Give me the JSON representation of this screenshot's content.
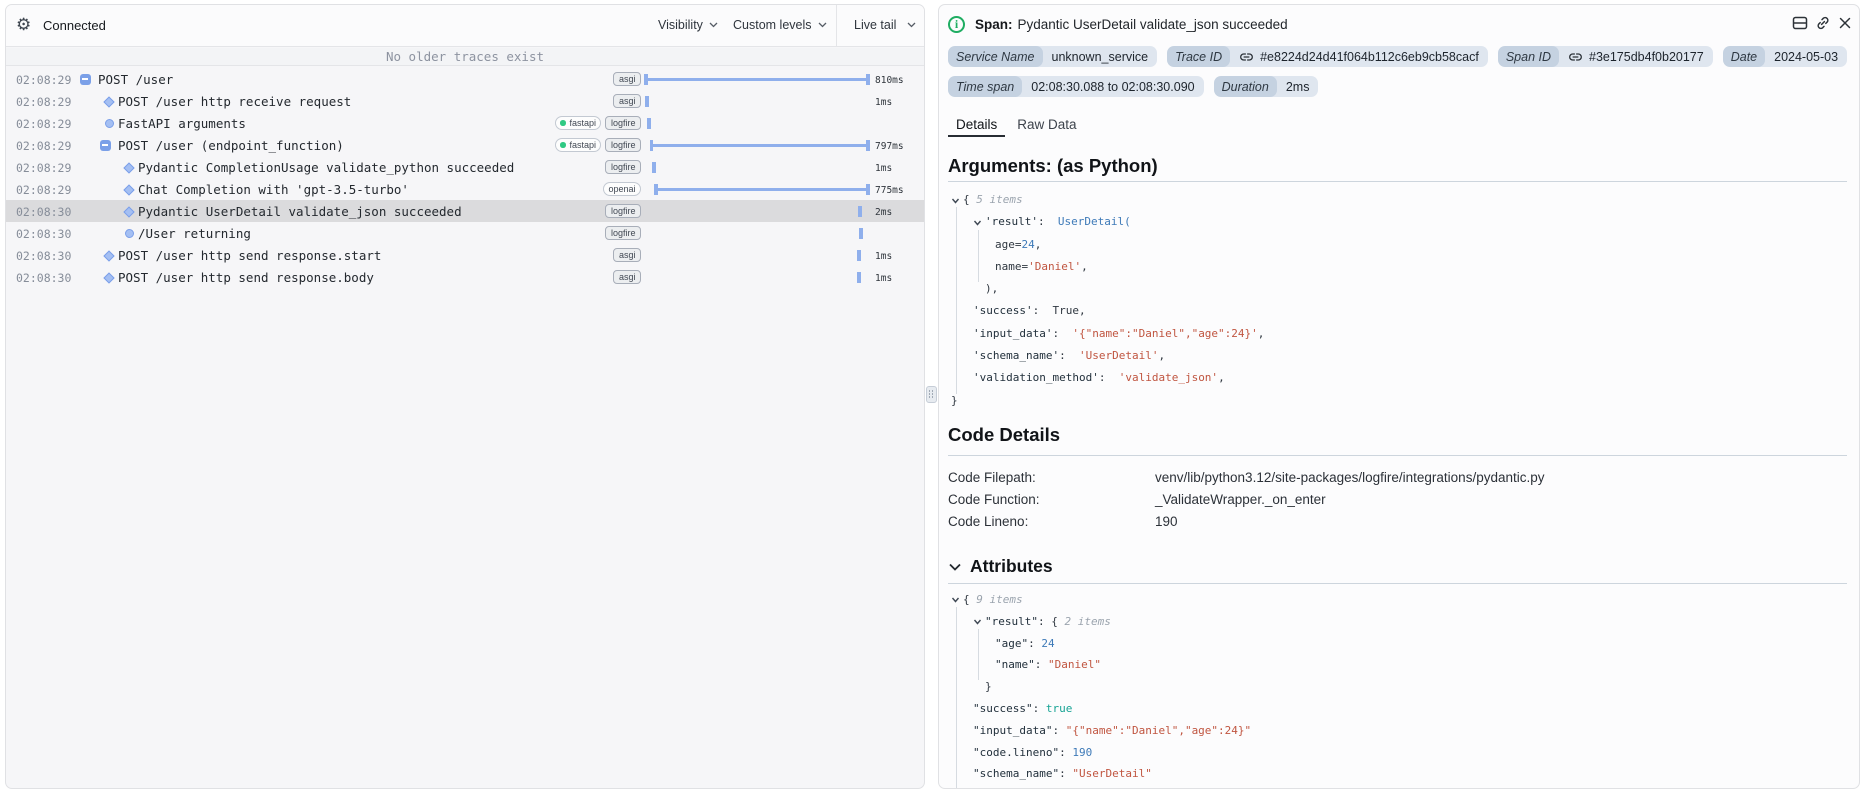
{
  "left_panel": {
    "header": {
      "status": "Connected",
      "visibility": "Visibility",
      "custom_levels": "Custom levels",
      "live_tail": "Live tail"
    },
    "banner": "No older traces exist",
    "rows": [
      {
        "time": "02:08:29",
        "icon": "minus",
        "level": 0,
        "text": "POST /user",
        "tags": [
          "asgi"
        ],
        "bar": {
          "type": "span",
          "start": 0.0,
          "end": 1.0
        },
        "duration": "810ms",
        "selected": false
      },
      {
        "time": "02:08:29",
        "icon": "diamond",
        "level": 1,
        "text": "POST /user http receive request",
        "tags": [
          "asgi"
        ],
        "bar": {
          "type": "tick",
          "start": 0.004
        },
        "duration": "1ms",
        "selected": false
      },
      {
        "time": "02:08:29",
        "icon": "circle",
        "level": 1,
        "text": "FastAPI arguments",
        "tags": [
          "fastapi",
          "logfire"
        ],
        "bar": {
          "type": "tick",
          "start": 0.012
        },
        "duration": "",
        "selected": false
      },
      {
        "time": "02:08:29",
        "icon": "minus",
        "level": 1,
        "text": "POST /user (endpoint_function)",
        "tags": [
          "fastapi",
          "logfire"
        ],
        "bar": {
          "type": "span",
          "start": 0.027,
          "end": 1.0
        },
        "duration": "797ms",
        "selected": false
      },
      {
        "time": "02:08:29",
        "icon": "diamond",
        "level": 2,
        "text": "Pydantic CompletionUsage validate_python succeeded",
        "tags": [
          "logfire"
        ],
        "bar": {
          "type": "tick",
          "start": 0.036
        },
        "duration": "1ms",
        "selected": false
      },
      {
        "time": "02:08:29",
        "icon": "diamond",
        "level": 2,
        "text": "Chat Completion with 'gpt-3.5-turbo'",
        "tags": [
          "openai"
        ],
        "bar": {
          "type": "span",
          "start": 0.046,
          "end": 1.0
        },
        "duration": "775ms",
        "selected": false
      },
      {
        "time": "02:08:30",
        "icon": "diamond",
        "level": 2,
        "text": "Pydantic UserDetail validate_json succeeded",
        "tags": [
          "logfire"
        ],
        "bar": {
          "type": "tick",
          "start": 0.962
        },
        "duration": "2ms",
        "selected": true
      },
      {
        "time": "02:08:30",
        "icon": "circle",
        "level": 2,
        "text": "/User returning",
        "tags": [
          "logfire"
        ],
        "bar": {
          "type": "tick",
          "start": 0.967
        },
        "duration": "",
        "selected": false
      },
      {
        "time": "02:08:30",
        "icon": "diamond",
        "level": 1,
        "text": "POST /user http send response.start",
        "tags": [
          "asgi"
        ],
        "bar": {
          "type": "tick",
          "start": 0.958
        },
        "duration": "1ms",
        "selected": false
      },
      {
        "time": "02:08:30",
        "icon": "diamond",
        "level": 1,
        "text": "POST /user http send response.body",
        "tags": [
          "asgi"
        ],
        "bar": {
          "type": "tick",
          "start": 0.958
        },
        "duration": "1ms",
        "selected": false
      }
    ],
    "tag_styles": {
      "asgi": "filled",
      "logfire": "filled",
      "fastapi": "outlined-dot",
      "openai": "outlined"
    }
  },
  "right_panel": {
    "title_label": "Span:",
    "title": "Pydantic UserDetail validate_json succeeded",
    "badges_row1": [
      {
        "label": "Service Name",
        "value": "unknown_service",
        "link": false
      },
      {
        "label": "Trace ID",
        "value": "#e8224d24d41f064b112c6eb9cb58cacf",
        "link": true
      },
      {
        "label": "Span ID",
        "value": "#3e175db4f0b20177",
        "link": true
      },
      {
        "label": "Date",
        "value": "2024-05-03",
        "link": false
      }
    ],
    "badges_row2": [
      {
        "label": "Time span",
        "value": "02:08:30.088 to 02:08:30.090",
        "link": false
      },
      {
        "label": "Duration",
        "value": "2ms",
        "link": false
      }
    ],
    "tabs": [
      {
        "label": "Details",
        "active": true
      },
      {
        "label": "Raw Data",
        "active": false
      }
    ],
    "args_heading": "Arguments: (as Python)",
    "args_lines": [
      {
        "indent": 0,
        "chevron": true,
        "tokens": [
          [
            "p",
            "{ "
          ],
          [
            "m",
            "5 items"
          ]
        ]
      },
      {
        "indent": 1,
        "chevron": true,
        "tokens": [
          [
            "k",
            "'result'"
          ],
          [
            "p",
            ":  "
          ],
          [
            "t",
            "UserDetail("
          ]
        ]
      },
      {
        "indent": 2,
        "chevron": false,
        "tokens": [
          [
            "p",
            "age="
          ],
          [
            "n",
            "24"
          ],
          [
            "p",
            ","
          ]
        ]
      },
      {
        "indent": 2,
        "chevron": false,
        "tokens": [
          [
            "p",
            "name="
          ],
          [
            "s",
            "'Daniel'"
          ],
          [
            "p",
            ","
          ]
        ]
      },
      {
        "indent": 1,
        "extra": 12,
        "chevron": false,
        "tokens": [
          [
            "p",
            "),"
          ]
        ]
      },
      {
        "indent": 1,
        "chevron": false,
        "tokens": [
          [
            "k",
            "'success'"
          ],
          [
            "p",
            ":  True,"
          ]
        ]
      },
      {
        "indent": 1,
        "chevron": false,
        "tokens": [
          [
            "k",
            "'input_data'"
          ],
          [
            "p",
            ":  "
          ],
          [
            "s",
            "'{\"name\":\"Daniel\",\"age\":24}'"
          ],
          [
            "p",
            ","
          ]
        ]
      },
      {
        "indent": 1,
        "chevron": false,
        "tokens": [
          [
            "k",
            "'schema_name'"
          ],
          [
            "p",
            ":  "
          ],
          [
            "s",
            "'UserDetail'"
          ],
          [
            "p",
            ","
          ]
        ]
      },
      {
        "indent": 1,
        "chevron": false,
        "tokens": [
          [
            "k",
            "'validation_method'"
          ],
          [
            "p",
            ":  "
          ],
          [
            "s",
            "'validate_json'"
          ],
          [
            "p",
            ","
          ]
        ]
      },
      {
        "indent": 0,
        "chevron": false,
        "tokens": [
          [
            "p",
            "}"
          ]
        ]
      }
    ],
    "args_guides": [
      {
        "level": 0,
        "from": 0,
        "to": 9
      },
      {
        "level": 1,
        "from": 1,
        "to": 4
      }
    ],
    "code_details": {
      "heading": "Code Details",
      "rows": [
        {
          "label": "Code Filepath:",
          "value": "venv/lib/python3.12/site-packages/logfire/integrations/pydantic.py"
        },
        {
          "label": "Code Function:",
          "value": "_ValidateWrapper._on_enter"
        },
        {
          "label": "Code Lineno:",
          "value": "190"
        }
      ]
    },
    "attributes_heading": "Attributes",
    "attr_lines": [
      {
        "indent": 0,
        "chevron": true,
        "tokens": [
          [
            "p",
            "{ "
          ],
          [
            "m",
            "9 items"
          ]
        ]
      },
      {
        "indent": 1,
        "chevron": true,
        "tokens": [
          [
            "k",
            "\"result\""
          ],
          [
            "p",
            ": { "
          ],
          [
            "m",
            "2 items"
          ]
        ]
      },
      {
        "indent": 2,
        "chevron": false,
        "tokens": [
          [
            "k",
            "\"age\""
          ],
          [
            "p",
            ": "
          ],
          [
            "n",
            "24"
          ]
        ]
      },
      {
        "indent": 2,
        "chevron": false,
        "tokens": [
          [
            "k",
            "\"name\""
          ],
          [
            "p",
            ": "
          ],
          [
            "s",
            "\"Daniel\""
          ]
        ]
      },
      {
        "indent": 1,
        "extra": 12,
        "chevron": false,
        "tokens": [
          [
            "p",
            "}"
          ]
        ]
      },
      {
        "indent": 1,
        "chevron": false,
        "tokens": [
          [
            "k",
            "\"success\""
          ],
          [
            "p",
            ": "
          ],
          [
            "b",
            "true"
          ]
        ]
      },
      {
        "indent": 1,
        "chevron": false,
        "tokens": [
          [
            "k",
            "\"input_data\""
          ],
          [
            "p",
            ": "
          ],
          [
            "s",
            "\"{\"name\":\"Daniel\",\"age\":24}\""
          ]
        ]
      },
      {
        "indent": 1,
        "chevron": false,
        "tokens": [
          [
            "k",
            "\"code.lineno\""
          ],
          [
            "p",
            ": "
          ],
          [
            "n",
            "190"
          ]
        ]
      },
      {
        "indent": 1,
        "chevron": false,
        "tokens": [
          [
            "k",
            "\"schema_name\""
          ],
          [
            "p",
            ": "
          ],
          [
            "s",
            "\"UserDetail\""
          ]
        ]
      }
    ],
    "attr_guides": [
      {
        "level": 0,
        "from": 0,
        "to": -1
      },
      {
        "level": 1,
        "from": 1,
        "to": 4
      }
    ]
  }
}
